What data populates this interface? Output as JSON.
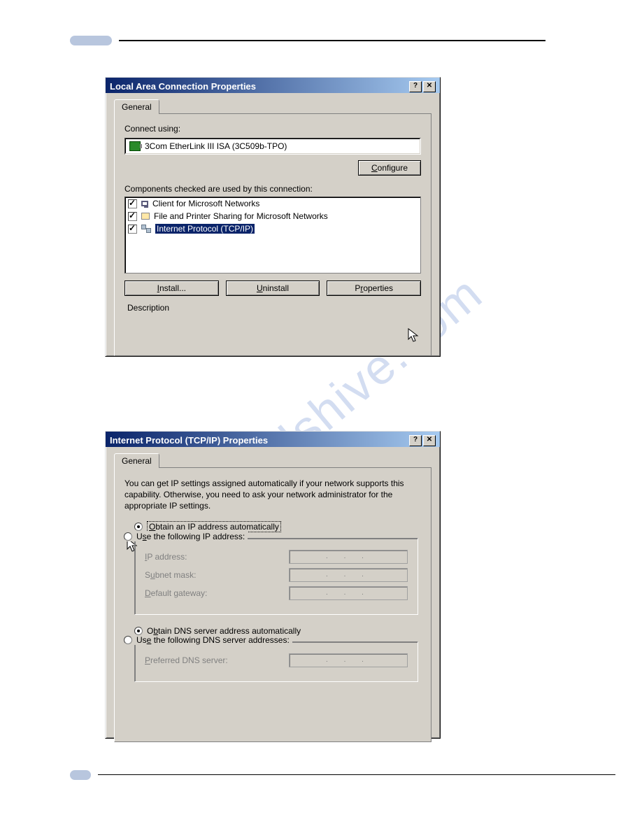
{
  "watermark": "manualshive.com",
  "dialog1": {
    "title": "Local Area Connection Properties",
    "tab": "General",
    "connect_label": "Connect using:",
    "adapter": "3Com EtherLink III ISA (3C509b-TPO)",
    "configure": "Configure",
    "components_label": "Components checked are used by this connection:",
    "items": [
      {
        "label": "Client for Microsoft Networks",
        "checked": true,
        "icon": "monitor"
      },
      {
        "label": "File and Printer Sharing for Microsoft Networks",
        "checked": true,
        "icon": "share"
      },
      {
        "label": "Internet Protocol (TCP/IP)",
        "checked": true,
        "icon": "net",
        "selected": true
      }
    ],
    "install": "Install...",
    "uninstall": "Uninstall",
    "properties": "Properties",
    "description": "Description"
  },
  "dialog2": {
    "title": "Internet Protocol (TCP/IP) Properties",
    "tab": "General",
    "help": "You can get IP settings assigned automatically if your network supports this capability. Otherwise, you need to ask your network administrator for the appropriate IP settings.",
    "obtain_ip": "Obtain an IP address automatically",
    "use_ip": "Use the following IP address:",
    "ip_address": "IP address:",
    "subnet": "Subnet mask:",
    "gateway": "Default gateway:",
    "obtain_dns": "Obtain DNS server address automatically",
    "use_dns": "Use the following DNS server addresses:",
    "pref_dns": "Preferred DNS server:",
    "dots": ".     .     ."
  },
  "titlebar": {
    "help": "?",
    "close": "✕"
  }
}
